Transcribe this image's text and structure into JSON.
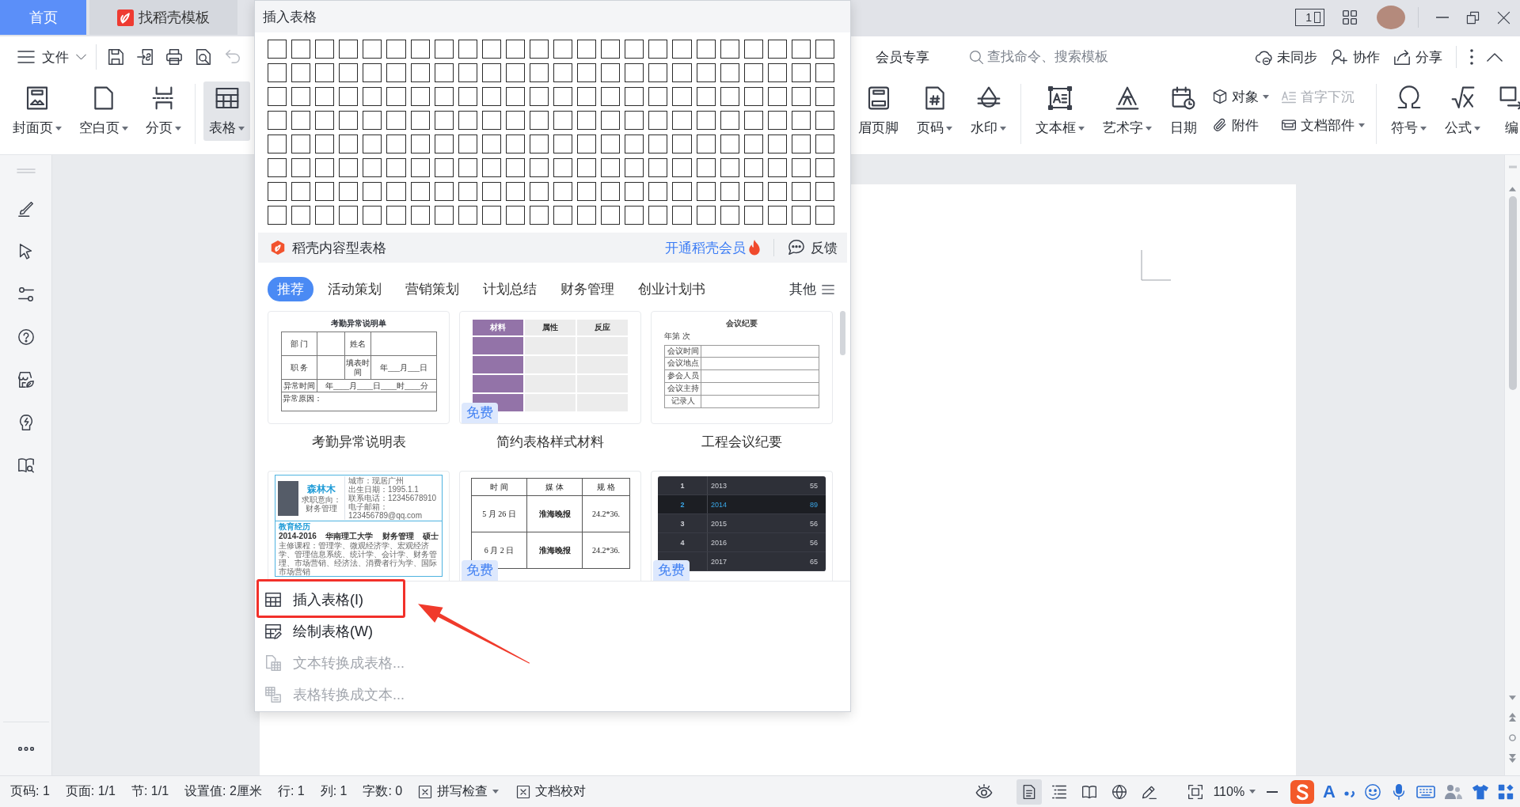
{
  "title_bar": {
    "tabs": [
      {
        "kind": "home",
        "label": "首页"
      },
      {
        "kind": "templates",
        "label": "找稻壳模板"
      }
    ],
    "page_indicator": "1"
  },
  "quick_bar": {
    "file_menu": "文件",
    "tools": [
      {
        "kind": "save",
        "disabled": false
      },
      {
        "kind": "export",
        "disabled": false
      },
      {
        "kind": "print",
        "disabled": false
      },
      {
        "kind": "preview",
        "disabled": false
      },
      {
        "kind": "undo",
        "disabled": true
      }
    ],
    "member": "会员专享",
    "search": {
      "placeholder": "查找命令、搜索模板"
    },
    "actions": [
      {
        "kind": "sync",
        "label": "未同步"
      },
      {
        "kind": "collaborate",
        "label": "协作"
      },
      {
        "kind": "share",
        "label": "分享"
      }
    ]
  },
  "ribbon": {
    "left_groups": [
      [
        {
          "kind": "cover",
          "label": "封面页",
          "dropdown": true,
          "pressed": false
        },
        {
          "kind": "blank",
          "label": "空白页",
          "dropdown": true,
          "pressed": false
        },
        {
          "kind": "break",
          "label": "分页",
          "dropdown": true,
          "pressed": false
        }
      ],
      [
        {
          "kind": "table",
          "label": "表格",
          "dropdown": true,
          "pressed": true
        }
      ]
    ],
    "right_groups": [
      [
        {
          "kind": "header_footer",
          "label": "眉页脚",
          "dropdown": false,
          "pressed": false
        },
        {
          "kind": "page_number",
          "label": "页码",
          "dropdown": true,
          "pressed": false
        },
        {
          "kind": "watermark",
          "label": "水印",
          "dropdown": true,
          "pressed": false
        }
      ],
      [
        {
          "kind": "text_box",
          "label": "文本框",
          "dropdown": true,
          "pressed": false
        },
        {
          "kind": "word_art",
          "label": "艺术字",
          "dropdown": true,
          "pressed": false
        },
        {
          "kind": "date",
          "label": "日期",
          "dropdown": false,
          "pressed": false
        },
        {
          "kind": "stack",
          "items": [
            {
              "kind": "object",
              "label": "对象",
              "dropdown": true,
              "disabled": false
            },
            {
              "kind": "attachment",
              "label": "附件",
              "dropdown": false,
              "disabled": false
            }
          ]
        },
        {
          "kind": "stack",
          "items": [
            {
              "kind": "drop_cap",
              "label": "首字下沉",
              "dropdown": false,
              "disabled": true
            },
            {
              "kind": "doc_parts",
              "label": "文档部件",
              "dropdown": true,
              "disabled": false
            }
          ]
        }
      ],
      [
        {
          "kind": "symbol",
          "label": "符号",
          "dropdown": true,
          "pressed": false
        },
        {
          "kind": "formula",
          "label": "公式",
          "dropdown": true,
          "pressed": false
        },
        {
          "kind": "numbering",
          "label": "编",
          "dropdown": false,
          "pressed": false
        }
      ]
    ]
  },
  "insert_table_panel": {
    "title": "插入表格",
    "table_picker": {
      "rows": [
        {
          "cells": [
            {
              "selected": false
            },
            {
              "selected": false
            },
            {
              "selected": false
            },
            {
              "selected": false
            },
            {
              "selected": false
            },
            {
              "selected": false
            },
            {
              "selected": false
            },
            {
              "selected": false
            },
            {
              "selected": false
            },
            {
              "selected": false
            },
            {
              "selected": false
            },
            {
              "selected": false
            },
            {
              "selected": false
            },
            {
              "selected": false
            },
            {
              "selected": false
            },
            {
              "selected": false
            },
            {
              "selected": false
            },
            {
              "selected": false
            },
            {
              "selected": false
            },
            {
              "selected": false
            },
            {
              "selected": false
            },
            {
              "selected": false
            },
            {
              "selected": false
            },
            {
              "selected": false
            }
          ]
        },
        {
          "cells": [
            {
              "selected": false
            },
            {
              "selected": false
            },
            {
              "selected": false
            },
            {
              "selected": false
            },
            {
              "selected": false
            },
            {
              "selected": false
            },
            {
              "selected": false
            },
            {
              "selected": false
            },
            {
              "selected": false
            },
            {
              "selected": false
            },
            {
              "selected": false
            },
            {
              "selected": false
            },
            {
              "selected": false
            },
            {
              "selected": false
            },
            {
              "selected": false
            },
            {
              "selected": false
            },
            {
              "selected": false
            },
            {
              "selected": false
            },
            {
              "selected": false
            },
            {
              "selected": false
            },
            {
              "selected": false
            },
            {
              "selected": false
            },
            {
              "selected": false
            },
            {
              "selected": false
            }
          ]
        },
        {
          "cells": [
            {
              "selected": false
            },
            {
              "selected": false
            },
            {
              "selected": false
            },
            {
              "selected": false
            },
            {
              "selected": false
            },
            {
              "selected": false
            },
            {
              "selected": false
            },
            {
              "selected": false
            },
            {
              "selected": false
            },
            {
              "selected": false
            },
            {
              "selected": false
            },
            {
              "selected": false
            },
            {
              "selected": false
            },
            {
              "selected": false
            },
            {
              "selected": false
            },
            {
              "selected": false
            },
            {
              "selected": false
            },
            {
              "selected": false
            },
            {
              "selected": false
            },
            {
              "selected": false
            },
            {
              "selected": false
            },
            {
              "selected": false
            },
            {
              "selected": false
            },
            {
              "selected": false
            }
          ]
        },
        {
          "cells": [
            {
              "selected": false
            },
            {
              "selected": false
            },
            {
              "selected": false
            },
            {
              "selected": false
            },
            {
              "selected": false
            },
            {
              "selected": false
            },
            {
              "selected": false
            },
            {
              "selected": false
            },
            {
              "selected": false
            },
            {
              "selected": false
            },
            {
              "selected": false
            },
            {
              "selected": false
            },
            {
              "selected": false
            },
            {
              "selected": false
            },
            {
              "selected": false
            },
            {
              "selected": false
            },
            {
              "selected": false
            },
            {
              "selected": false
            },
            {
              "selected": false
            },
            {
              "selected": false
            },
            {
              "selected": false
            },
            {
              "selected": false
            },
            {
              "selected": false
            },
            {
              "selected": false
            }
          ]
        },
        {
          "cells": [
            {
              "selected": false
            },
            {
              "selected": false
            },
            {
              "selected": false
            },
            {
              "selected": false
            },
            {
              "selected": false
            },
            {
              "selected": false
            },
            {
              "selected": false
            },
            {
              "selected": false
            },
            {
              "selected": false
            },
            {
              "selected": false
            },
            {
              "selected": false
            },
            {
              "selected": false
            },
            {
              "selected": false
            },
            {
              "selected": false
            },
            {
              "selected": false
            },
            {
              "selected": false
            },
            {
              "selected": false
            },
            {
              "selected": false
            },
            {
              "selected": false
            },
            {
              "selected": false
            },
            {
              "selected": false
            },
            {
              "selected": false
            },
            {
              "selected": false
            },
            {
              "selected": false
            }
          ]
        },
        {
          "cells": [
            {
              "selected": false
            },
            {
              "selected": false
            },
            {
              "selected": false
            },
            {
              "selected": false
            },
            {
              "selected": false
            },
            {
              "selected": false
            },
            {
              "selected": false
            },
            {
              "selected": false
            },
            {
              "selected": false
            },
            {
              "selected": false
            },
            {
              "selected": false
            },
            {
              "selected": false
            },
            {
              "selected": false
            },
            {
              "selected": false
            },
            {
              "selected": false
            },
            {
              "selected": false
            },
            {
              "selected": false
            },
            {
              "selected": false
            },
            {
              "selected": false
            },
            {
              "selected": false
            },
            {
              "selected": false
            },
            {
              "selected": false
            },
            {
              "selected": false
            },
            {
              "selected": false
            }
          ]
        },
        {
          "cells": [
            {
              "selected": false
            },
            {
              "selected": false
            },
            {
              "selected": false
            },
            {
              "selected": false
            },
            {
              "selected": false
            },
            {
              "selected": false
            },
            {
              "selected": false
            },
            {
              "selected": false
            },
            {
              "selected": false
            },
            {
              "selected": false
            },
            {
              "selected": false
            },
            {
              "selected": false
            },
            {
              "selected": false
            },
            {
              "selected": false
            },
            {
              "selected": false
            },
            {
              "selected": false
            },
            {
              "selected": false
            },
            {
              "selected": false
            },
            {
              "selected": false
            },
            {
              "selected": false
            },
            {
              "selected": false
            },
            {
              "selected": false
            },
            {
              "selected": false
            },
            {
              "selected": false
            }
          ]
        },
        {
          "cells": [
            {
              "selected": false
            },
            {
              "selected": false
            },
            {
              "selected": false
            },
            {
              "selected": false
            },
            {
              "selected": false
            },
            {
              "selected": false
            },
            {
              "selected": false
            },
            {
              "selected": false
            },
            {
              "selected": false
            },
            {
              "selected": false
            },
            {
              "selected": false
            },
            {
              "selected": false
            },
            {
              "selected": false
            },
            {
              "selected": false
            },
            {
              "selected": false
            },
            {
              "selected": false
            },
            {
              "selected": false
            },
            {
              "selected": false
            },
            {
              "selected": false
            },
            {
              "selected": false
            },
            {
              "selected": false
            },
            {
              "selected": false
            },
            {
              "selected": false
            },
            {
              "selected": false
            }
          ]
        }
      ]
    },
    "promo_bar": {
      "title": "稻壳内容型表格",
      "membership_link": "开通稻壳会员",
      "feedback": "反馈"
    },
    "categories": [
      {
        "label": "推荐",
        "selected": true
      },
      {
        "label": "活动策划",
        "selected": false
      },
      {
        "label": "营销策划",
        "selected": false
      },
      {
        "label": "计划总结",
        "selected": false
      },
      {
        "label": "财务管理",
        "selected": false
      },
      {
        "label": "创业计划书",
        "selected": false
      }
    ],
    "more_categories": "其他",
    "templates": [
      {
        "kind": "form",
        "title": "考勤异常说明表",
        "preview": {
          "heading": "考勤异常说明单",
          "department_label": "部 门",
          "name_label": "姓名",
          "position_label": "职 务",
          "fill_date_label": "填表时间",
          "fill_date_value": "年___月___日",
          "time_label": "异常时间",
          "time_value": "年____月____日____时____分",
          "reason_label": "异常原因："
        }
      },
      {
        "kind": "color_table",
        "title": "简约表格样式材料",
        "badge": "免费",
        "preview": {
          "headers": [
            "材料",
            "属性",
            "反应"
          ]
        }
      },
      {
        "kind": "minutes",
        "title": "工程会议纪要",
        "preview": {
          "heading": "会议纪要",
          "session": "年第 次",
          "labels": [
            "会议时间",
            "会议地点",
            "参会人员",
            "会议主持",
            "记录人"
          ]
        }
      },
      {
        "kind": "resume",
        "preview": {
          "name": "森林木",
          "objective": "求职意向：财务管理",
          "details": [
            "城市：现居广州",
            "出生日期：1995.1.1",
            "联系电话：12345678910",
            "电子邮箱：",
            "123456789@qq.com"
          ],
          "section": "教育经历",
          "education": [
            "2014-2016",
            "华南理工大学",
            "财务管理",
            "硕士"
          ],
          "courses": "主修课程：管理学、微观经济学、宏观经济学、管理信息系统、统计学、会计学、财务管理、市场营销、经济法、消费者行为学、国际市场营销"
        }
      },
      {
        "kind": "media_table",
        "badge": "免费",
        "preview": {
          "headers": [
            "时 间",
            "媒 体",
            "规 格"
          ],
          "rows": [
            [
              "5 月 26 日",
              "淮海晚报",
              "24.2*36."
            ],
            [
              "6 月 2 日",
              "淮海晚报",
              "24.2*36."
            ]
          ]
        }
      },
      {
        "kind": "data_table",
        "badge": "免费",
        "preview": {
          "rows": [
            {
              "index": "1",
              "year": "2013",
              "value": "55",
              "highlighted": false
            },
            {
              "index": "2",
              "year": "2014",
              "value": "89",
              "highlighted": true
            },
            {
              "index": "3",
              "year": "2015",
              "value": "56",
              "highlighted": false
            },
            {
              "index": "4",
              "year": "2016",
              "value": "56",
              "highlighted": false
            },
            {
              "year": "2017",
              "value": "65",
              "highlighted": false
            }
          ]
        }
      }
    ],
    "menu": [
      {
        "kind": "insert",
        "label": "插入表格(I)",
        "disabled": false,
        "highlighted": true
      },
      {
        "kind": "draw",
        "label": "绘制表格(W)",
        "disabled": false,
        "highlighted": false
      },
      {
        "kind": "text_to_table",
        "label": "文本转换成表格...",
        "disabled": true,
        "highlighted": false
      },
      {
        "kind": "table_to_text",
        "label": "表格转换成文本...",
        "disabled": true,
        "highlighted": false
      }
    ]
  },
  "status_bar": {
    "fields": [
      "页码: 1",
      "页面: 1/1",
      "节: 1/1",
      "设置值: 2厘米",
      "行: 1",
      "列: 1",
      "字数: 0"
    ],
    "tools": [
      {
        "label": "拼写检查",
        "dropdown": true
      },
      {
        "label": "文档校对",
        "dropdown": false
      }
    ],
    "views": [
      {
        "kind": "page",
        "selected": true
      },
      {
        "kind": "outline",
        "selected": false
      },
      {
        "kind": "reading",
        "selected": false
      },
      {
        "kind": "web",
        "selected": false
      },
      {
        "kind": "writing",
        "selected": false
      }
    ],
    "zoom": "110%",
    "ime": {
      "mode": "A"
    }
  }
}
